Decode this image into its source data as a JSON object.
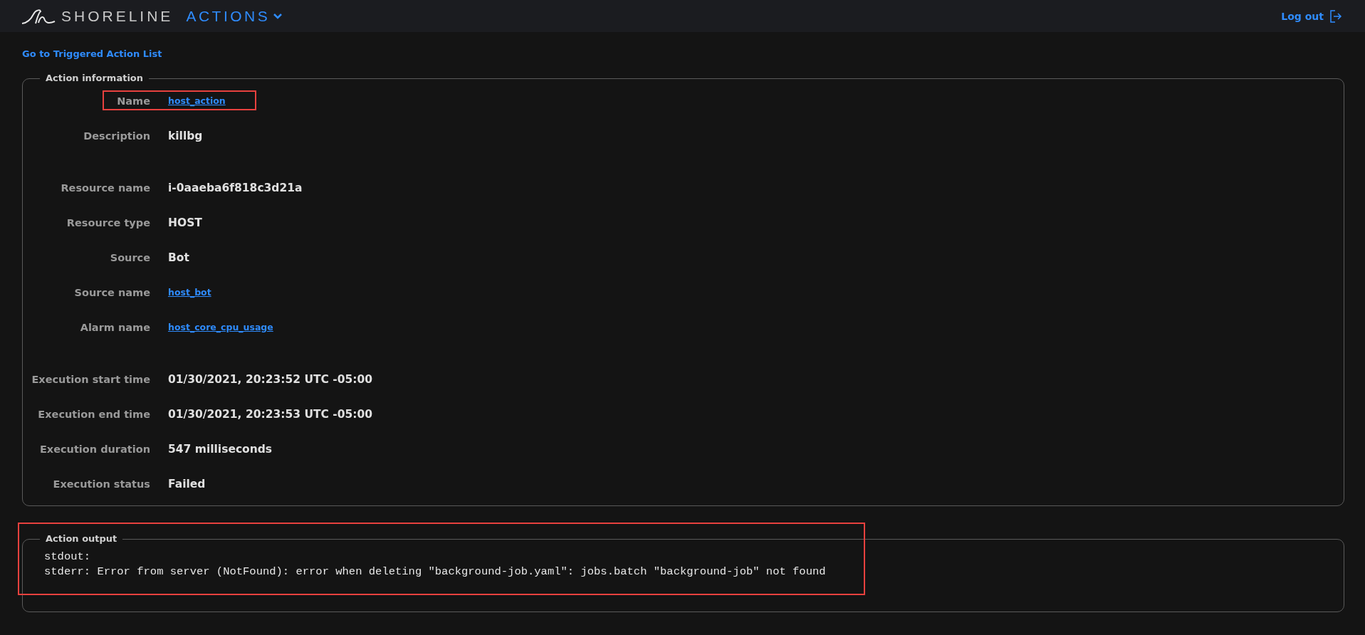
{
  "header": {
    "brand": "SHORELINE",
    "app": "ACTIONS",
    "logout": "Log out"
  },
  "back_link": "Go to Triggered Action List",
  "action_information": {
    "title": "Action information",
    "groups": [
      {
        "fields": [
          {
            "label": "Name",
            "value": "host_action",
            "kind": "link",
            "highlighted": true
          },
          {
            "label": "Description",
            "value": "killbg",
            "kind": "text",
            "highlighted": false
          }
        ]
      },
      {
        "fields": [
          {
            "label": "Resource name",
            "value": "i-0aaeba6f818c3d21a",
            "kind": "text",
            "highlighted": false
          },
          {
            "label": "Resource type",
            "value": "HOST",
            "kind": "text",
            "highlighted": false
          },
          {
            "label": "Source",
            "value": "Bot",
            "kind": "text",
            "highlighted": false
          },
          {
            "label": "Source name",
            "value": "host_bot",
            "kind": "link",
            "highlighted": false
          },
          {
            "label": "Alarm name",
            "value": "host_core_cpu_usage",
            "kind": "link",
            "highlighted": false
          }
        ]
      },
      {
        "fields": [
          {
            "label": "Execution start time",
            "value": "01/30/2021, 20:23:52 UTC -05:00",
            "kind": "text",
            "highlighted": false
          },
          {
            "label": "Execution end time",
            "value": "01/30/2021, 20:23:53 UTC -05:00",
            "kind": "text",
            "highlighted": false
          },
          {
            "label": "Execution duration",
            "value": "547 milliseconds",
            "kind": "text",
            "highlighted": false
          },
          {
            "label": "Execution status",
            "value": "Failed",
            "kind": "text",
            "highlighted": false
          }
        ]
      }
    ]
  },
  "action_output": {
    "title": "Action output",
    "highlighted": true,
    "lines": [
      "stdout:",
      "stderr: Error from server (NotFound): error when deleting \"background-job.yaml\": jobs.batch \"background-job\" not found"
    ]
  }
}
